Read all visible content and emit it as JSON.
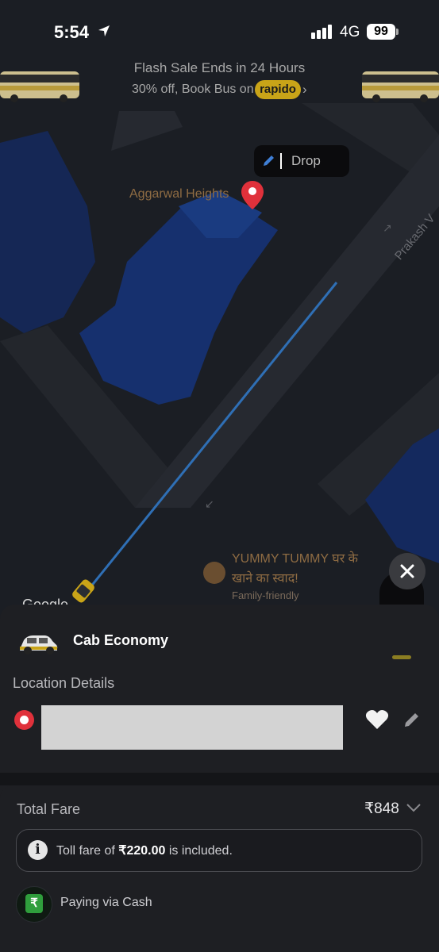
{
  "status_bar": {
    "time": "5:54",
    "network": "4G",
    "battery": "99"
  },
  "banner": {
    "title": "Flash Sale Ends in 24 Hours",
    "subtitle": "30% off, Book Bus on",
    "brand": "rapido",
    "chevron": "›"
  },
  "map": {
    "drop_label": "Drop",
    "place_aggarwal": "Aggarwal Heights",
    "street_name": "Prakash V",
    "restaurant_name": "YUMMY TUMMY घर के खाने का स्वाद!",
    "restaurant_tag": "Family-friendly",
    "google_label": "Google",
    "close_glyph": "✕"
  },
  "ride": {
    "title": "Cab Economy"
  },
  "location_details": {
    "header": "Location Details"
  },
  "fare": {
    "label": "Total Fare",
    "amount": "₹848",
    "toll_prefix": "Toll fare of ",
    "toll_amount": "₹220.00",
    "toll_suffix": " is included.",
    "info_glyph": "i"
  },
  "payment": {
    "text": "Paying via Cash",
    "currency_glyph": "₹"
  },
  "colors": {
    "accent": "#c9a418",
    "route": "#2f6fb5",
    "pin": "#e0313b",
    "cash": "#2f9e3c"
  },
  "icons": [
    "location-arrow-icon",
    "signal-icon",
    "bus-icon",
    "edit-icon",
    "pin-icon",
    "car-icon",
    "heart-icon",
    "pencil-icon",
    "chevron-down-icon",
    "info-icon",
    "cash-icon",
    "close-icon",
    "recenter-icon",
    "restaurant-icon"
  ]
}
